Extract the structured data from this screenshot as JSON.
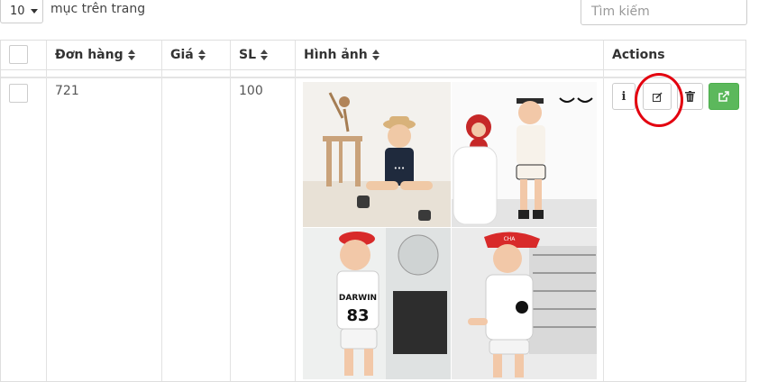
{
  "length_menu": {
    "value": "10",
    "label": "mục trên trang"
  },
  "search": {
    "placeholder": "Tìm kiếm"
  },
  "columns": [
    "Đơn hàng",
    "Giá",
    "SL",
    "Hình ảnh",
    "Actions"
  ],
  "rows": [
    {
      "order": "721",
      "price": "",
      "qty": "100"
    }
  ],
  "icons": [
    "info-icon",
    "edit-icon",
    "trash-icon",
    "external-link-icon"
  ],
  "colors": {
    "accent_green": "#5cb85c",
    "highlight_circle": "#e3000f"
  }
}
